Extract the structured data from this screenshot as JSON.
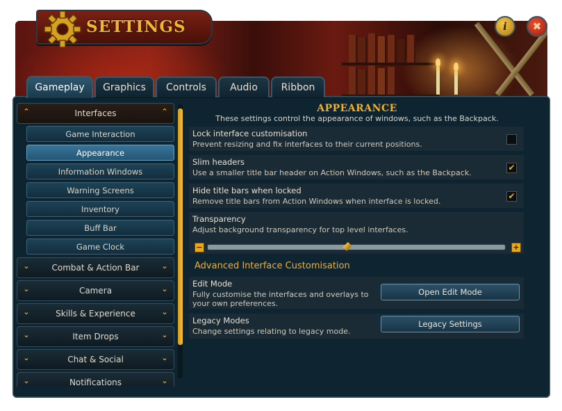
{
  "window": {
    "title": "SETTINGS",
    "accent": "#f0b030",
    "info_icon": "info-icon",
    "close_icon": "close-icon",
    "info_glyph": "i",
    "close_glyph": "✖"
  },
  "tabs": [
    {
      "label": "Gameplay",
      "active": true
    },
    {
      "label": "Graphics",
      "active": false
    },
    {
      "label": "Controls",
      "active": false
    },
    {
      "label": "Audio",
      "active": false
    },
    {
      "label": "Ribbon",
      "active": false
    }
  ],
  "sidebar": {
    "interfaces": {
      "label": "Interfaces",
      "expanded": true,
      "items": [
        {
          "label": "Game Interaction"
        },
        {
          "label": "Appearance",
          "selected": true
        },
        {
          "label": "Information Windows"
        },
        {
          "label": "Warning Screens"
        },
        {
          "label": "Inventory"
        },
        {
          "label": "Buff Bar"
        },
        {
          "label": "Game Clock"
        }
      ]
    },
    "categories": [
      {
        "label": "Combat & Action Bar"
      },
      {
        "label": "Camera"
      },
      {
        "label": "Skills & Experience"
      },
      {
        "label": "Item Drops"
      },
      {
        "label": "Chat & Social"
      },
      {
        "label": "Notifications"
      }
    ]
  },
  "appearance": {
    "title": "APPEARANCE",
    "description": "These settings control the appearance of windows, such as the Backpack.",
    "options": [
      {
        "title": "Lock interface customisation",
        "description": "Prevent resizing and fix interfaces to their current positions.",
        "checked": false
      },
      {
        "title": "Slim headers",
        "description": "Use a smaller title bar header on Action Windows, such as the Backpack.",
        "checked": true
      },
      {
        "title": "Hide title bars when locked",
        "description": "Remove title bars from Action Windows when interface is locked.",
        "checked": true
      }
    ],
    "transparency": {
      "title": "Transparency",
      "description": "Adjust background transparency for top level interfaces.",
      "value_fraction": 0.47,
      "minus": "−",
      "plus": "+"
    },
    "check_glyph": "✔"
  },
  "advanced": {
    "title": "Advanced Interface Customisation",
    "edit_mode": {
      "title": "Edit Mode",
      "description": "Fully customise the interfaces and overlays to your own preferences.",
      "button": "Open Edit Mode"
    },
    "legacy": {
      "title": "Legacy Modes",
      "description": "Change settings relating to legacy mode.",
      "button": "Legacy Settings"
    }
  }
}
